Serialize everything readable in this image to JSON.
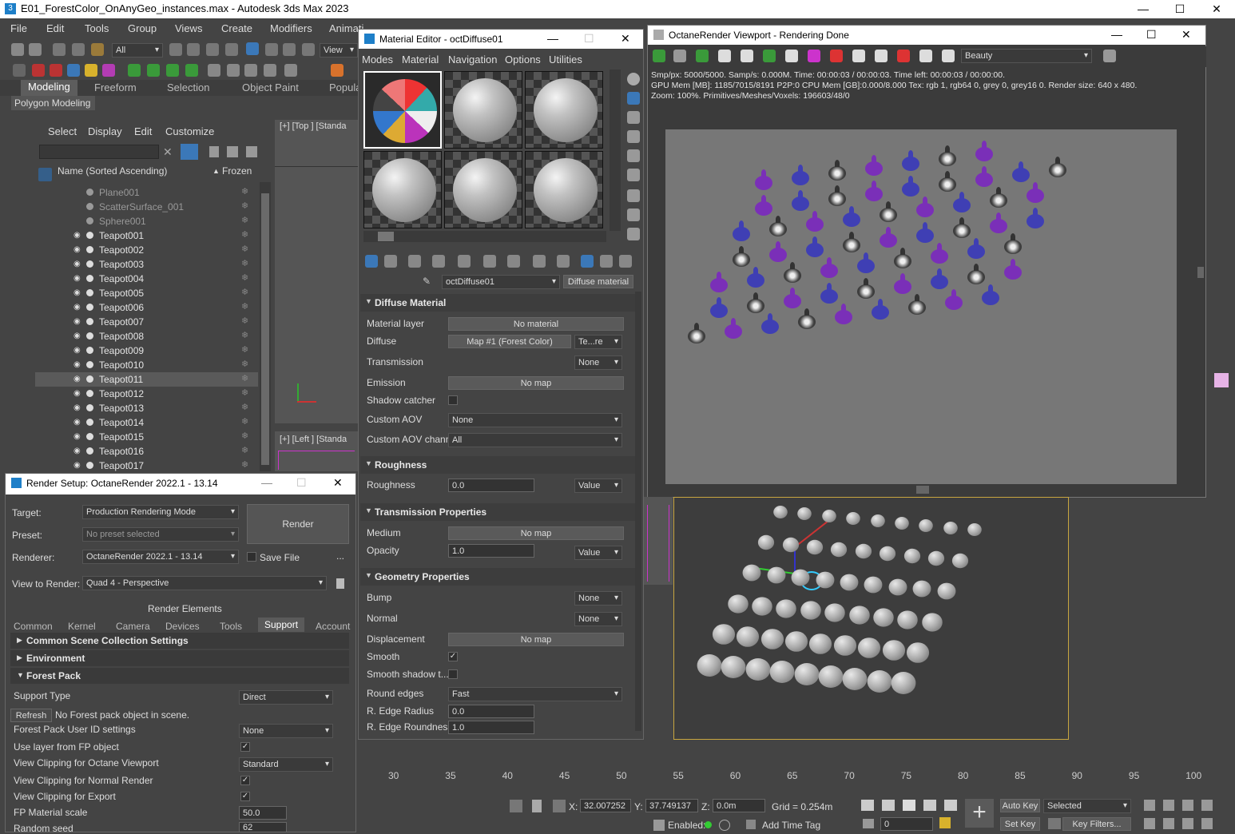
{
  "app": {
    "title": "E01_ForestColor_OnAnyGeo_instances.max - Autodesk 3ds Max 2023",
    "icon_label": "3",
    "window_buttons": [
      "—",
      "☐",
      "✕"
    ]
  },
  "menubar": [
    "File",
    "Edit",
    "Tools",
    "Group",
    "Views",
    "Create",
    "Modifiers",
    "Animati"
  ],
  "toolbar": {
    "selection_filter": "All",
    "view": "View"
  },
  "ribbon": {
    "tabs": [
      "Modeling",
      "Freeform",
      "Selection",
      "Object Paint",
      "Popula"
    ],
    "panel": "Polygon Modeling"
  },
  "scene_explorer": {
    "menu": [
      "Select",
      "Display",
      "Edit",
      "Customize"
    ],
    "col_name": "Name (Sorted Ascending)",
    "col_frozen": "Frozen",
    "sort_arrow": "▲",
    "rows": [
      {
        "name": "Plane001",
        "hidden": true
      },
      {
        "name": "ScatterSurface_001",
        "hidden": true
      },
      {
        "name": "Sphere001",
        "hidden": true
      },
      {
        "name": "Teapot001"
      },
      {
        "name": "Teapot002"
      },
      {
        "name": "Teapot003"
      },
      {
        "name": "Teapot004"
      },
      {
        "name": "Teapot005"
      },
      {
        "name": "Teapot006"
      },
      {
        "name": "Teapot007"
      },
      {
        "name": "Teapot008"
      },
      {
        "name": "Teapot009"
      },
      {
        "name": "Teapot010"
      },
      {
        "name": "Teapot011",
        "selected": true
      },
      {
        "name": "Teapot012"
      },
      {
        "name": "Teapot013"
      },
      {
        "name": "Teapot014"
      },
      {
        "name": "Teapot015"
      },
      {
        "name": "Teapot016"
      },
      {
        "name": "Teapot017"
      }
    ]
  },
  "viewports": {
    "top_label": "[+] [Top ] [Standa",
    "left_label": "[+] [Left ] [Standa"
  },
  "material_editor": {
    "title": "Material Editor - octDiffuse01",
    "menu": [
      "Modes",
      "Material",
      "Navigation",
      "Options",
      "Utilities"
    ],
    "material_name": "octDiffuse01",
    "material_type": "Diffuse material",
    "sections": {
      "diffuse": "Diffuse Material",
      "roughness": "Roughness",
      "transmission": "Transmission Properties",
      "geometry": "Geometry Properties"
    },
    "fields": {
      "material_layer": {
        "label": "Material layer",
        "value": "No material"
      },
      "diffuse": {
        "label": "Diffuse",
        "value": "Map #1 (Forest Color)",
        "mode": "Te...re"
      },
      "transmission": {
        "label": "Transmission",
        "mode": "None"
      },
      "emission": {
        "label": "Emission",
        "value": "No map"
      },
      "shadow_catcher": {
        "label": "Shadow catcher"
      },
      "custom_aov": {
        "label": "Custom AOV",
        "value": "None"
      },
      "custom_aov_channel": {
        "label": "Custom AOV channel",
        "value": "All"
      },
      "roughness": {
        "label": "Roughness",
        "value": "0.0",
        "mode": "Value"
      },
      "medium": {
        "label": "Medium",
        "value": "No map"
      },
      "opacity": {
        "label": "Opacity",
        "value": "1.0",
        "mode": "Value"
      },
      "bump": {
        "label": "Bump",
        "mode": "None"
      },
      "normal": {
        "label": "Normal",
        "mode": "None"
      },
      "displacement": {
        "label": "Displacement",
        "value": "No map"
      },
      "smooth": {
        "label": "Smooth",
        "checked": "✓"
      },
      "smooth_shadow": {
        "label": "Smooth shadow t..."
      },
      "round_edges": {
        "label": "Round edges",
        "value": "Fast"
      },
      "r_edge_radius": {
        "label": "R. Edge Radius",
        "value": "0.0"
      },
      "r_edge_roundness": {
        "label": "R. Edge Roundness",
        "value": "1.0"
      }
    }
  },
  "octane": {
    "title": "OctaneRender Viewport - Rendering Done",
    "pass": "Beauty",
    "info1": "Smp/px: 5000/5000.   Samp/s: 0.000M.   Time: 00:00:03 / 00:00:03.   Time left: 00:00:03 / 00:00:00.",
    "info2": "GPU Mem [MB]: 1185/7015/8191 P2P:0   CPU Mem [GB]:0.000/8.000   Tex: rgb 1, rgb64 0, grey 0, grey16 0.   Render size: 640 x 480.",
    "info3": "Zoom: 100%.   Primitives/Meshes/Voxels: 196603/48/0",
    "teapot_colors": {
      "purple": "#7a2fb8",
      "red": "#c7333a",
      "blue": "#3f3fb4",
      "ghost": "#8fa08f",
      "bw": "#d8d8d8",
      "floral": "#d8672c"
    }
  },
  "render_setup": {
    "title": "Render Setup: OctaneRender 2022.1 - 13.14",
    "target_label": "Target:",
    "target": "Production Rendering Mode",
    "preset_label": "Preset:",
    "preset": "No preset selected",
    "renderer_label": "Renderer:",
    "renderer": "OctaneRender 2022.1 - 13.14",
    "save_file": "Save File",
    "more": "...",
    "view_label": "View to Render:",
    "view": "Quad 4 - Perspective",
    "render_button": "Render",
    "render_elements": "Render Elements",
    "tabs": [
      "Common",
      "Kernel",
      "Camera",
      "Devices",
      "Tools",
      "Support",
      "Account"
    ],
    "sections": [
      "Common Scene Collection Settings",
      "Environment",
      "Forest Pack"
    ],
    "support_type_label": "Support Type",
    "support_type": "Direct",
    "refresh": "Refresh",
    "refresh_msg": "No Forest pack object in scene.",
    "fp_user_id_label": "Forest Pack User ID settings",
    "fp_user_id": "None",
    "use_layer_label": "Use layer from FP object",
    "view_clip_octane_label": "View Clipping for Octane Viewport",
    "view_clip_octane": "Standard",
    "view_clip_normal_label": "View Clipping for Normal Render",
    "view_clip_export_label": "View Clipping for Export",
    "fp_mat_scale_label": "FP Material scale",
    "fp_mat_scale": "50.0",
    "random_seed_label": "Random seed",
    "random_seed": "62"
  },
  "timeline": {
    "ticks": [
      "30",
      "35",
      "40",
      "45",
      "50",
      "55",
      "60",
      "65",
      "70",
      "75",
      "80",
      "85",
      "90",
      "95",
      "100"
    ]
  },
  "status": {
    "x_label": "X:",
    "x": "32.007252",
    "y_label": "Y:",
    "y": "37.749137",
    "z_label": "Z:",
    "z": "0.0m",
    "grid": "Grid = 0.254m",
    "enabled": "Enabled:",
    "add_time_tag": "Add Time Tag",
    "auto_key": "Auto Key",
    "set_key": "Set Key",
    "selected": "Selected",
    "key_filters": "Key Filters...",
    "frame": "0"
  }
}
